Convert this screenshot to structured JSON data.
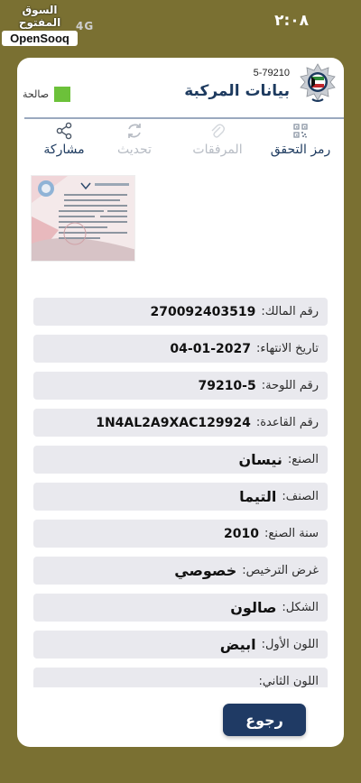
{
  "status_bar": {
    "time": "٢:٠٨",
    "signal_text": "4G"
  },
  "watermark": {
    "arabic": "السوق المفتوح",
    "latin": "OpenSooq"
  },
  "header": {
    "vehicle_number": "5-79210",
    "title": "بيانات المركبة",
    "status_label": "صالحة",
    "status_color": "#6cc13a",
    "emblem_icon": "kuwait-police-emblem"
  },
  "toolbar": {
    "qr_label": "رمز التحقق",
    "attachments_label": "المرفقات",
    "refresh_label": "تحديث",
    "share_label": "مشاركة",
    "qr_icon": "qr-code-icon",
    "attachments_icon": "attachment-icon",
    "refresh_icon": "refresh-icon",
    "share_icon": "share-icon"
  },
  "fields": [
    {
      "label": "رقم المالك:",
      "value": "270092403519"
    },
    {
      "label": "تاريخ الانتهاء:",
      "value": "04-01-2027"
    },
    {
      "label": "رقم اللوحة:",
      "value": "79210-5"
    },
    {
      "label": "رقم القاعدة:",
      "value": "1N4AL2A9XAC129924"
    },
    {
      "label": "الصنع:",
      "value": "نيسان"
    },
    {
      "label": "الصنف:",
      "value": "التيما"
    },
    {
      "label": "سنة الصنع:",
      "value": "2010"
    },
    {
      "label": "غرض الترخيص:",
      "value": "خصوصي"
    },
    {
      "label": "الشكل:",
      "value": "صالون"
    },
    {
      "label": "اللون الأول:",
      "value": "ابيض"
    },
    {
      "label": "اللون الثاني:",
      "value": ""
    }
  ],
  "footer": {
    "back_label": "رجوع"
  },
  "colors": {
    "background": "#7a7032",
    "primary": "#1f3a64",
    "row_background": "#e9e9ee"
  }
}
